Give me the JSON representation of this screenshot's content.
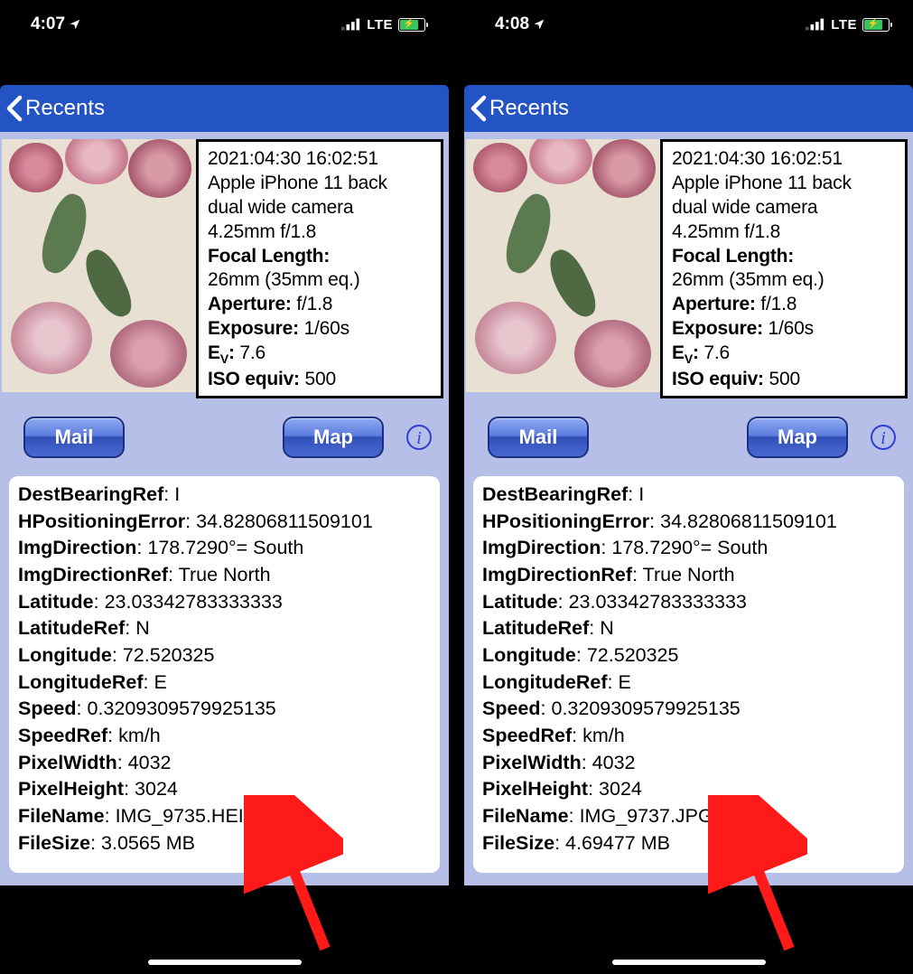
{
  "phones": [
    {
      "statusbar": {
        "time": "4:07",
        "network": "LTE"
      },
      "nav": {
        "back_label": "Recents"
      },
      "info": {
        "timestamp": "2021:04:30 16:02:51",
        "camera_line1": "Apple iPhone 11 back",
        "camera_line2": "dual wide camera",
        "camera_line3": "4.25mm f/1.8",
        "focal_label": "Focal Length:",
        "focal_value": "26mm (35mm eq.)",
        "aperture_label": "Aperture:",
        "aperture_value": "f/1.8",
        "exposure_label": "Exposure:",
        "exposure_value": "1/60s",
        "ev_label_pre": "E",
        "ev_label_sub": "V",
        "ev_label_post": ":",
        "ev_value": "7.6",
        "iso_label": "ISO equiv:",
        "iso_value": "500"
      },
      "buttons": {
        "mail": "Mail",
        "map": "Map"
      },
      "meta": {
        "DestBearingRef": "I",
        "HPositioningError": "34.82806811509101",
        "ImgDirection": "178.7290°= South",
        "ImgDirectionRef": "True North",
        "Latitude": "23.03342783333333",
        "LatitudeRef": "N",
        "Longitude": "72.520325",
        "LongitudeRef": "E",
        "Speed": "0.3209309579925135",
        "SpeedRef": "km/h",
        "PixelWidth": "4032",
        "PixelHeight": "3024",
        "FileName": "IMG_9735.HEIC",
        "FileSize": "3.0565 MB"
      }
    },
    {
      "statusbar": {
        "time": "4:08",
        "network": "LTE"
      },
      "nav": {
        "back_label": "Recents"
      },
      "info": {
        "timestamp": "2021:04:30 16:02:51",
        "camera_line1": "Apple iPhone 11 back",
        "camera_line2": "dual wide camera",
        "camera_line3": "4.25mm f/1.8",
        "focal_label": "Focal Length:",
        "focal_value": "26mm (35mm eq.)",
        "aperture_label": "Aperture:",
        "aperture_value": "f/1.8",
        "exposure_label": "Exposure:",
        "exposure_value": "1/60s",
        "ev_label_pre": "E",
        "ev_label_sub": "V",
        "ev_label_post": ":",
        "ev_value": "7.6",
        "iso_label": "ISO equiv:",
        "iso_value": "500"
      },
      "buttons": {
        "mail": "Mail",
        "map": "Map"
      },
      "meta": {
        "DestBearingRef": "I",
        "HPositioningError": "34.82806811509101",
        "ImgDirection": "178.7290°= South",
        "ImgDirectionRef": "True North",
        "Latitude": "23.03342783333333",
        "LatitudeRef": "N",
        "Longitude": "72.520325",
        "LongitudeRef": "E",
        "Speed": "0.3209309579925135",
        "SpeedRef": "km/h",
        "PixelWidth": "4032",
        "PixelHeight": "3024",
        "FileName": "IMG_9737.JPG",
        "FileSize": "4.69477 MB"
      }
    }
  ],
  "meta_labels": {
    "DestBearingRef": "DestBearingRef",
    "HPositioningError": "HPositioningError",
    "ImgDirection": "ImgDirection",
    "ImgDirectionRef": "ImgDirectionRef",
    "Latitude": "Latitude",
    "LatitudeRef": "LatitudeRef",
    "Longitude": "Longitude",
    "LongitudeRef": "LongitudeRef",
    "Speed": "Speed",
    "SpeedRef": "SpeedRef",
    "PixelWidth": "PixelWidth",
    "PixelHeight": "PixelHeight",
    "FileName": "FileName",
    "FileSize": "FileSize"
  }
}
